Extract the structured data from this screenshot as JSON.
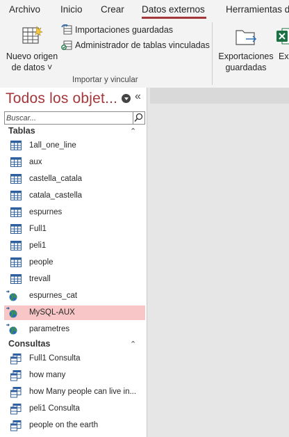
{
  "menubar": {
    "tabs": [
      {
        "label": "Archivo",
        "active": false
      },
      {
        "label": "Inicio",
        "active": false
      },
      {
        "label": "Crear",
        "active": false
      },
      {
        "label": "Datos externos",
        "active": true
      },
      {
        "label": "Herramientas de b",
        "active": false
      }
    ]
  },
  "ribbon": {
    "new_source_line1": "Nuevo origen",
    "new_source_line2": "de datos ˅",
    "saved_imports": "Importaciones guardadas",
    "linked_table_manager": "Administrador de tablas vinculadas",
    "group_label": "Importar y vincular",
    "saved_exports_line1": "Exportaciones",
    "saved_exports_line2": "guardadas",
    "excel_partial": "Exc"
  },
  "nav": {
    "title": "Todos los objet...",
    "collapse_glyph": "«",
    "search_placeholder": "Buscar...",
    "sections": [
      {
        "title": "Tablas",
        "toggle": "⌃",
        "items": [
          {
            "label": "1all_one_line",
            "icon": "table-icon"
          },
          {
            "label": "aux",
            "icon": "table-icon"
          },
          {
            "label": "castella_catala",
            "icon": "table-icon"
          },
          {
            "label": "catala_castella",
            "icon": "table-icon"
          },
          {
            "label": "espurnes",
            "icon": "table-icon"
          },
          {
            "label": "Full1",
            "icon": "table-icon"
          },
          {
            "label": "peli1",
            "icon": "table-icon"
          },
          {
            "label": "people",
            "icon": "table-icon"
          },
          {
            "label": "trevall",
            "icon": "table-icon"
          },
          {
            "label": "espurnes_cat",
            "icon": "linked-globe-icon"
          },
          {
            "label": "MySQL-AUX",
            "icon": "linked-globe-icon",
            "selected": true
          },
          {
            "label": "parametres",
            "icon": "linked-globe-icon"
          }
        ]
      },
      {
        "title": "Consultas",
        "toggle": "⌃",
        "items": [
          {
            "label": "Full1 Consulta",
            "icon": "query-icon"
          },
          {
            "label": "how many",
            "icon": "query-icon"
          },
          {
            "label": "how Many people can live  in...",
            "icon": "query-icon"
          },
          {
            "label": "peli1 Consulta",
            "icon": "query-icon"
          },
          {
            "label": "people on the earth",
            "icon": "query-icon"
          }
        ]
      }
    ]
  },
  "colors": {
    "accent": "#a4373a",
    "selection": "#f8c6c6",
    "table_icon": "#2e5f9e",
    "excel_green": "#1d7044"
  }
}
